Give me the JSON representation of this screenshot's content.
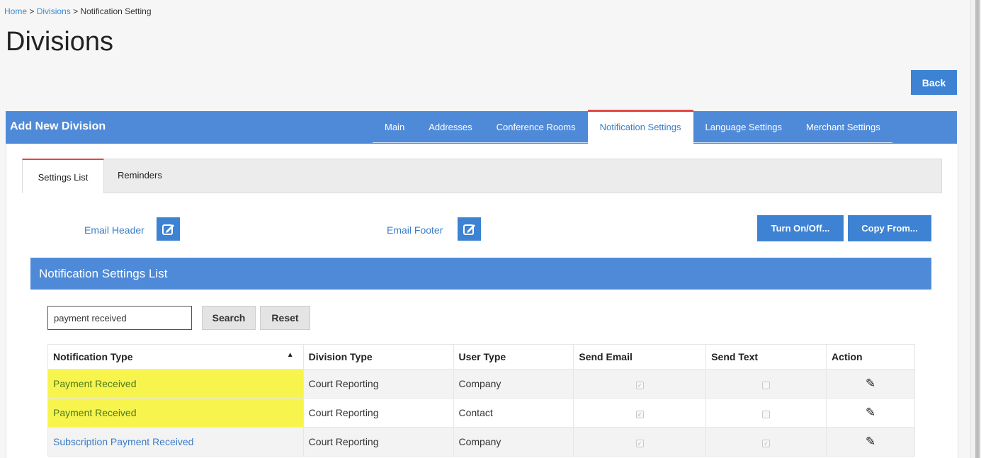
{
  "breadcrumb": {
    "home": "Home",
    "sep": ">",
    "divisions": "Divisions",
    "current": "Notification Setting"
  },
  "page_title": "Divisions",
  "back_label": "Back",
  "panel": {
    "title": "Add New Division",
    "tabs": [
      "Main",
      "Addresses",
      "Conference Rooms",
      "Notification Settings",
      "Language Settings",
      "Merchant Settings"
    ],
    "active_tab": "Notification Settings"
  },
  "sub_tabs": {
    "settings_list": "Settings List",
    "reminders": "Reminders"
  },
  "email_header_label": "Email Header",
  "email_footer_label": "Email Footer",
  "turn_on_off_label": "Turn On/Off...",
  "copy_from_label": "Copy From...",
  "list_title": "Notification Settings List",
  "search": {
    "value": "payment received",
    "search_label": "Search",
    "reset_label": "Reset"
  },
  "table": {
    "headers": [
      "Notification Type",
      "Division Type",
      "User Type",
      "Send Email",
      "Send Text",
      "Action"
    ],
    "rows": [
      {
        "notification_type": "Payment Received",
        "division_type": "Court Reporting",
        "user_type": "Company",
        "send_email": true,
        "send_text": false
      },
      {
        "notification_type": "Payment Received",
        "division_type": "Court Reporting",
        "user_type": "Contact",
        "send_email": true,
        "send_text": false
      },
      {
        "notification_type": "Subscription Payment Received",
        "division_type": "Court Reporting",
        "user_type": "Company",
        "send_email": true,
        "send_text": true
      }
    ]
  },
  "colors": {
    "primary": "#3d82d3",
    "header": "#4f8ad8",
    "active_tab_border": "#e04848",
    "highlight": "#f8f44e"
  }
}
